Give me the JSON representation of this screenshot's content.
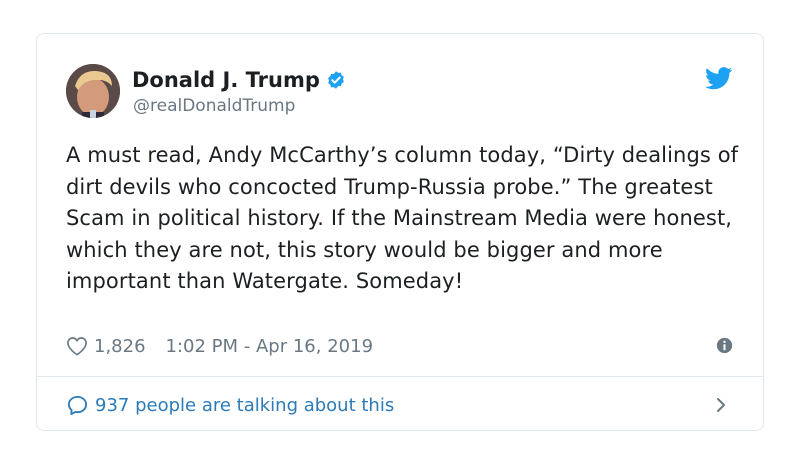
{
  "tweet": {
    "display_name": "Donald J. Trump",
    "handle": "@realDonaldTrump",
    "text": "A must read, Andy McCarthy’s column today, “Dirty dealings of dirt devils who concocted Trump-Russia probe.” The greatest Scam in political history. If the Mainstream Media were honest, which they are not, this story would be bigger and more important than Watergate. Someday!",
    "likes": "1,826",
    "timestamp": "1:02 PM - Apr 16, 2019",
    "talking": "937 people are talking about this"
  },
  "icons": {
    "avatar": "avatar-photo",
    "verified": "verified-badge-icon",
    "brand": "twitter-bird-icon",
    "like": "heart-icon",
    "info": "info-icon",
    "reply": "speech-bubble-icon",
    "more": "chevron-right-icon"
  },
  "colors": {
    "brand": "#1da1f2",
    "link": "#2b7bb9",
    "muted": "#697882",
    "border": "#e1e8ed",
    "text": "#1c2022"
  }
}
